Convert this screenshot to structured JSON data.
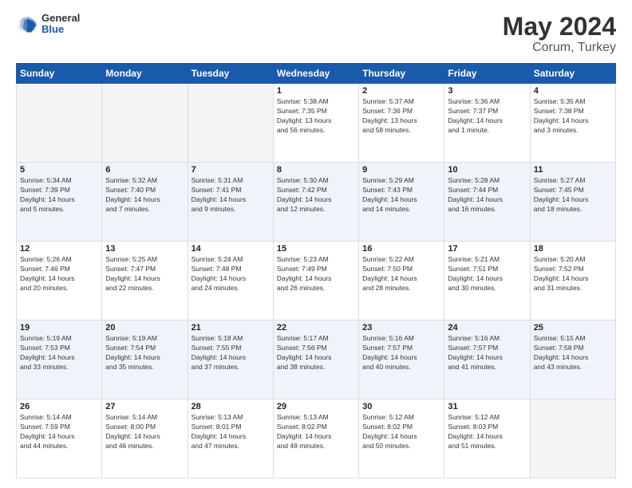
{
  "header": {
    "logo_general": "General",
    "logo_blue": "Blue",
    "title": "May 2024",
    "subtitle": "Corum, Turkey"
  },
  "weekdays": [
    "Sunday",
    "Monday",
    "Tuesday",
    "Wednesday",
    "Thursday",
    "Friday",
    "Saturday"
  ],
  "weeks": [
    [
      {
        "day": "",
        "info": ""
      },
      {
        "day": "",
        "info": ""
      },
      {
        "day": "",
        "info": ""
      },
      {
        "day": "1",
        "info": "Sunrise: 5:38 AM\nSunset: 7:35 PM\nDaylight: 13 hours\nand 56 minutes."
      },
      {
        "day": "2",
        "info": "Sunrise: 5:37 AM\nSunset: 7:36 PM\nDaylight: 13 hours\nand 58 minutes."
      },
      {
        "day": "3",
        "info": "Sunrise: 5:36 AM\nSunset: 7:37 PM\nDaylight: 14 hours\nand 1 minute."
      },
      {
        "day": "4",
        "info": "Sunrise: 5:35 AM\nSunset: 7:38 PM\nDaylight: 14 hours\nand 3 minutes."
      }
    ],
    [
      {
        "day": "5",
        "info": "Sunrise: 5:34 AM\nSunset: 7:39 PM\nDaylight: 14 hours\nand 5 minutes."
      },
      {
        "day": "6",
        "info": "Sunrise: 5:32 AM\nSunset: 7:40 PM\nDaylight: 14 hours\nand 7 minutes."
      },
      {
        "day": "7",
        "info": "Sunrise: 5:31 AM\nSunset: 7:41 PM\nDaylight: 14 hours\nand 9 minutes."
      },
      {
        "day": "8",
        "info": "Sunrise: 5:30 AM\nSunset: 7:42 PM\nDaylight: 14 hours\nand 12 minutes."
      },
      {
        "day": "9",
        "info": "Sunrise: 5:29 AM\nSunset: 7:43 PM\nDaylight: 14 hours\nand 14 minutes."
      },
      {
        "day": "10",
        "info": "Sunrise: 5:28 AM\nSunset: 7:44 PM\nDaylight: 14 hours\nand 16 minutes."
      },
      {
        "day": "11",
        "info": "Sunrise: 5:27 AM\nSunset: 7:45 PM\nDaylight: 14 hours\nand 18 minutes."
      }
    ],
    [
      {
        "day": "12",
        "info": "Sunrise: 5:26 AM\nSunset: 7:46 PM\nDaylight: 14 hours\nand 20 minutes."
      },
      {
        "day": "13",
        "info": "Sunrise: 5:25 AM\nSunset: 7:47 PM\nDaylight: 14 hours\nand 22 minutes."
      },
      {
        "day": "14",
        "info": "Sunrise: 5:24 AM\nSunset: 7:48 PM\nDaylight: 14 hours\nand 24 minutes."
      },
      {
        "day": "15",
        "info": "Sunrise: 5:23 AM\nSunset: 7:49 PM\nDaylight: 14 hours\nand 26 minutes."
      },
      {
        "day": "16",
        "info": "Sunrise: 5:22 AM\nSunset: 7:50 PM\nDaylight: 14 hours\nand 28 minutes."
      },
      {
        "day": "17",
        "info": "Sunrise: 5:21 AM\nSunset: 7:51 PM\nDaylight: 14 hours\nand 30 minutes."
      },
      {
        "day": "18",
        "info": "Sunrise: 5:20 AM\nSunset: 7:52 PM\nDaylight: 14 hours\nand 31 minutes."
      }
    ],
    [
      {
        "day": "19",
        "info": "Sunrise: 5:19 AM\nSunset: 7:53 PM\nDaylight: 14 hours\nand 33 minutes."
      },
      {
        "day": "20",
        "info": "Sunrise: 5:19 AM\nSunset: 7:54 PM\nDaylight: 14 hours\nand 35 minutes."
      },
      {
        "day": "21",
        "info": "Sunrise: 5:18 AM\nSunset: 7:55 PM\nDaylight: 14 hours\nand 37 minutes."
      },
      {
        "day": "22",
        "info": "Sunrise: 5:17 AM\nSunset: 7:56 PM\nDaylight: 14 hours\nand 38 minutes."
      },
      {
        "day": "23",
        "info": "Sunrise: 5:16 AM\nSunset: 7:57 PM\nDaylight: 14 hours\nand 40 minutes."
      },
      {
        "day": "24",
        "info": "Sunrise: 5:16 AM\nSunset: 7:57 PM\nDaylight: 14 hours\nand 41 minutes."
      },
      {
        "day": "25",
        "info": "Sunrise: 5:15 AM\nSunset: 7:58 PM\nDaylight: 14 hours\nand 43 minutes."
      }
    ],
    [
      {
        "day": "26",
        "info": "Sunrise: 5:14 AM\nSunset: 7:59 PM\nDaylight: 14 hours\nand 44 minutes."
      },
      {
        "day": "27",
        "info": "Sunrise: 5:14 AM\nSunset: 8:00 PM\nDaylight: 14 hours\nand 46 minutes."
      },
      {
        "day": "28",
        "info": "Sunrise: 5:13 AM\nSunset: 8:01 PM\nDaylight: 14 hours\nand 47 minutes."
      },
      {
        "day": "29",
        "info": "Sunrise: 5:13 AM\nSunset: 8:02 PM\nDaylight: 14 hours\nand 48 minutes."
      },
      {
        "day": "30",
        "info": "Sunrise: 5:12 AM\nSunset: 8:02 PM\nDaylight: 14 hours\nand 50 minutes."
      },
      {
        "day": "31",
        "info": "Sunrise: 5:12 AM\nSunset: 8:03 PM\nDaylight: 14 hours\nand 51 minutes."
      },
      {
        "day": "",
        "info": ""
      }
    ]
  ]
}
